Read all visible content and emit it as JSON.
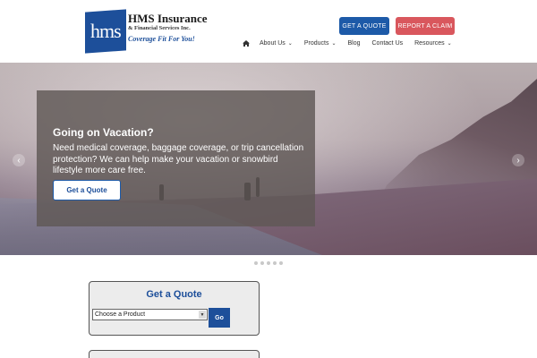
{
  "brand": {
    "logo_initials": "hms",
    "name": "HMS Insurance",
    "subtitle": "& Financial Services Inc.",
    "tagline": "Coverage Fit For You!",
    "primary_color": "#1d4f9a",
    "claim_color": "#d9575d"
  },
  "header": {
    "quote_button": "GET A QUOTE",
    "claim_button": "REPORT A CLAIM"
  },
  "nav": {
    "home_icon": "home-icon",
    "items": [
      {
        "label": "About Us",
        "has_dropdown": true
      },
      {
        "label": "Products",
        "has_dropdown": true
      },
      {
        "label": "Blog",
        "has_dropdown": false
      },
      {
        "label": "Contact Us",
        "has_dropdown": false
      },
      {
        "label": "Resources",
        "has_dropdown": true
      }
    ]
  },
  "hero": {
    "title": "Going on Vacation?",
    "text": "Need medical coverage, baggage coverage, or trip cancellation protection? We can help make your vacation or snowbird lifestyle more care free.",
    "button": "Get a Quote",
    "prev_icon": "chevron-left-icon",
    "next_icon": "chevron-right-icon",
    "slide_count": 5
  },
  "quote_widget": {
    "title": "Get a Quote",
    "select_value": "Choose a Product",
    "go_button": "Go"
  }
}
